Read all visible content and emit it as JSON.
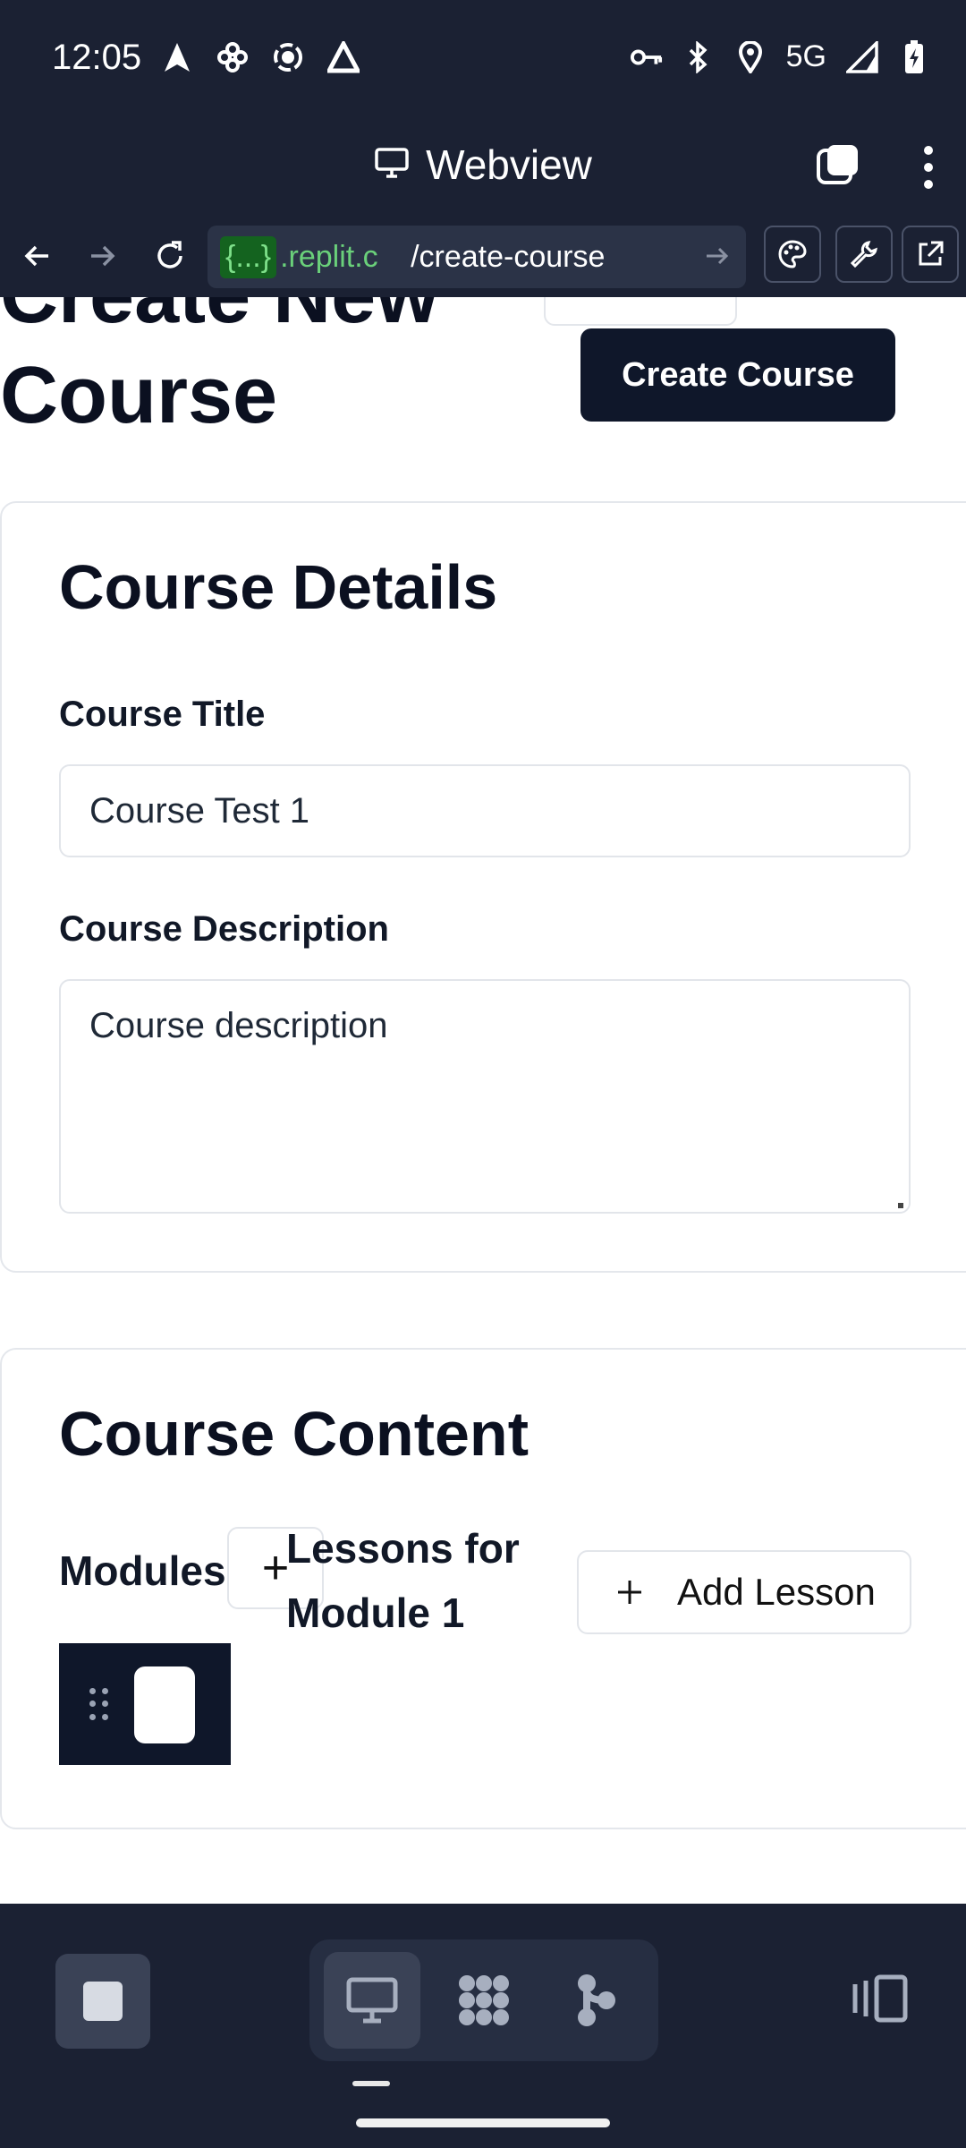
{
  "status_bar": {
    "time": "12:05",
    "network": "5G"
  },
  "webview": {
    "title": "Webview"
  },
  "url_bar": {
    "prefix": "{...}",
    "host": ".replit.c",
    "path": "/create-course"
  },
  "page": {
    "title": "Create New Course",
    "create_button": "Create Course"
  },
  "details": {
    "title": "Course Details",
    "course_title_label": "Course Title",
    "course_title_value": "Course Test 1",
    "description_label": "Course Description",
    "description_placeholder": "Course description"
  },
  "content": {
    "title": "Course Content",
    "modules_label": "Modules",
    "add_module_glyph": "+",
    "lessons_label": "Lessons for Module 1",
    "add_lesson_label": "Add Lesson"
  },
  "colors": {
    "chrome_bg": "#1b2133",
    "primary_button": "#0f172a",
    "url_host": "#6ad07a"
  }
}
